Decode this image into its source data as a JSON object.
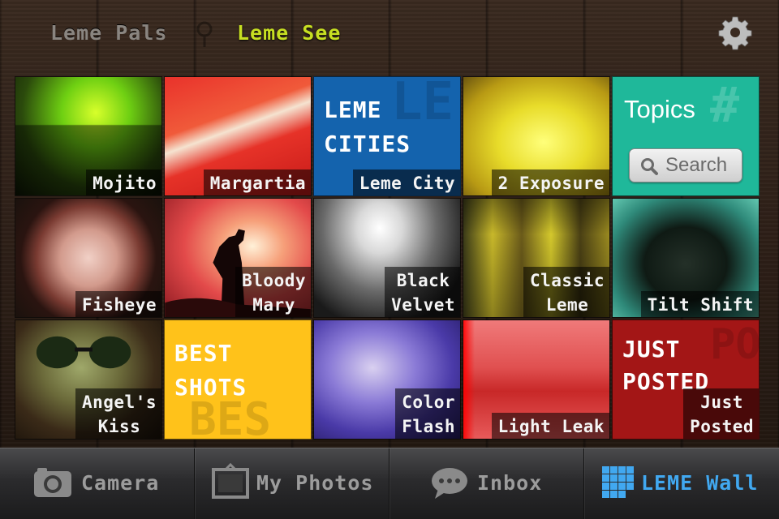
{
  "top_tabs": {
    "leme_pals": "Leme Pals",
    "leme_see": "Leme See"
  },
  "tiles": [
    {
      "label": "Mojito"
    },
    {
      "label": "Margartia"
    },
    {
      "label": "Leme City",
      "big": "LEME\nCITIES"
    },
    {
      "label": "2 Exposure"
    },
    {
      "title": "Topics",
      "search": "Search"
    },
    {
      "label": "Fisheye"
    },
    {
      "label": "Bloody\nMary"
    },
    {
      "label": "Black\nVelvet"
    },
    {
      "label": "Classic\nLeme"
    },
    {
      "label": "Tilt Shift"
    },
    {
      "label": "Angel's\nKiss"
    },
    {
      "big": "BEST\nSHOTS"
    },
    {
      "label": "Color\nFlash"
    },
    {
      "label": "Light Leak"
    },
    {
      "label": "Just\nPosted",
      "big": "JUST\nPOSTED"
    }
  ],
  "bottom_nav": {
    "camera": "Camera",
    "my_photos": "My Photos",
    "inbox": "Inbox",
    "leme_wall": "LEME Wall"
  },
  "colors": {
    "accent_green": "#c7df22",
    "accent_blue": "#41a8f0",
    "tile_cities_blue": "#1463ad",
    "tile_topics_teal": "#1fb89a",
    "tile_best_yellow": "#ffc21a",
    "tile_posted_red": "#a31616"
  },
  "icons": [
    "gear-icon",
    "camera-icon",
    "photo-frame-icon",
    "speech-bubble-icon",
    "grid-icon",
    "search-icon"
  ]
}
